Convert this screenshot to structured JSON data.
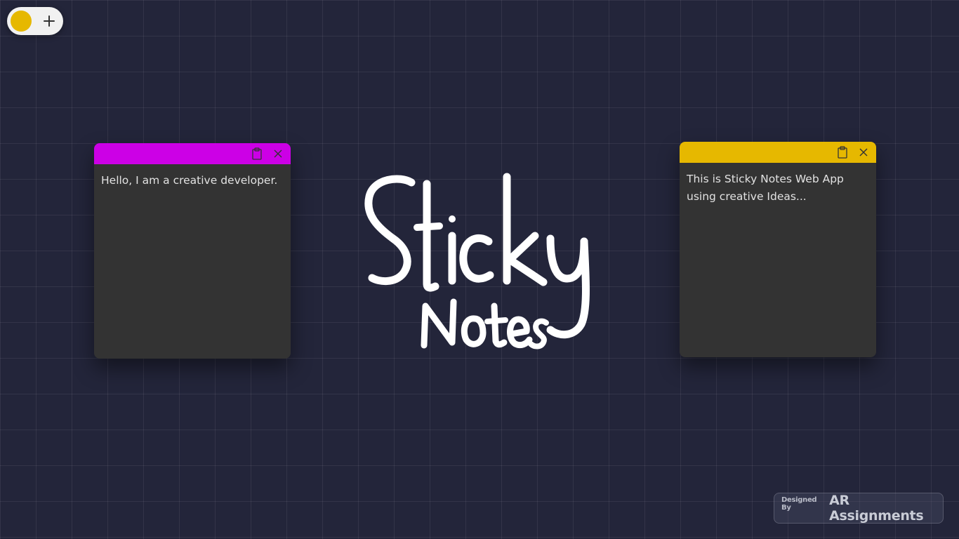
{
  "toolbar": {
    "selected_color": "#e6b800",
    "add_label": "+"
  },
  "notes": [
    {
      "header_color": "#cc00e6",
      "text": "Hello, I am a creative developer.",
      "copy_icon": "clipboard-icon",
      "close_icon": "close-icon"
    },
    {
      "header_color": "#e6b800",
      "text": "This is Sticky Notes Web App using creative Ideas...",
      "copy_icon": "clipboard-icon",
      "close_icon": "close-icon"
    }
  ],
  "hero": {
    "line1": "Sticky",
    "line2": "Notes"
  },
  "credit": {
    "prefix": "Designed By",
    "name": "AR Assignments"
  }
}
